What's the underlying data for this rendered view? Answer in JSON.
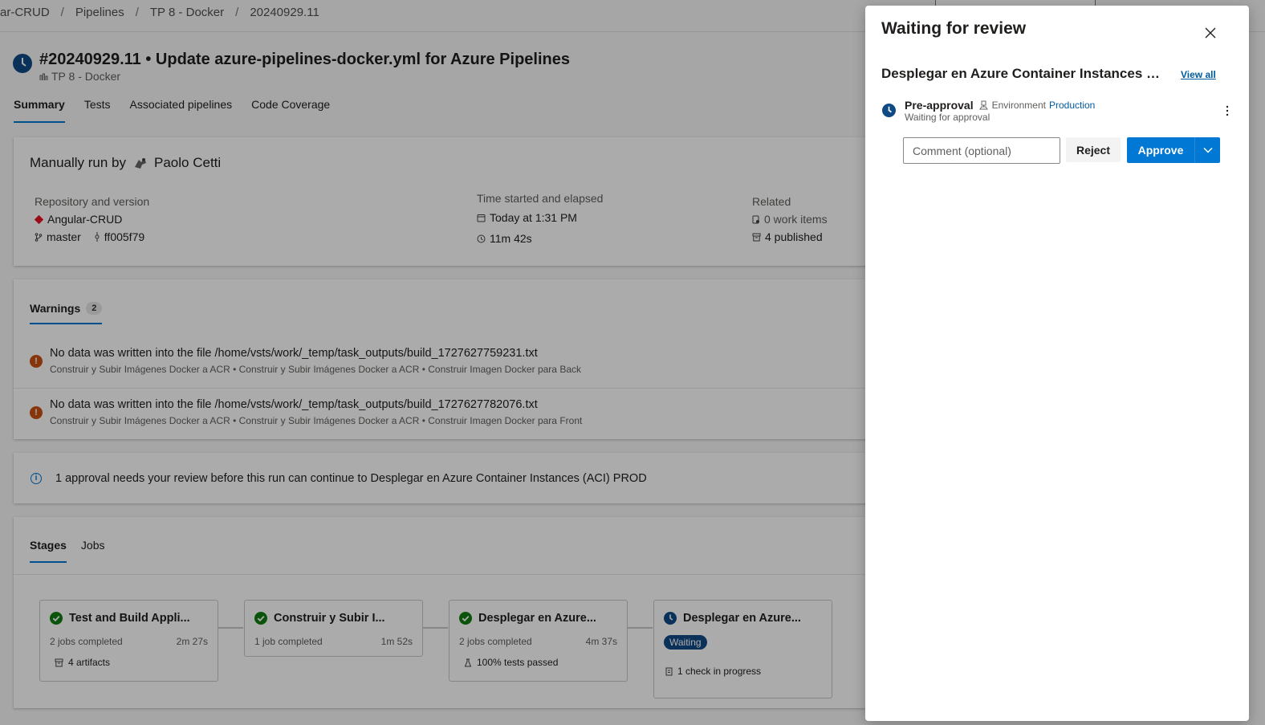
{
  "breadcrumb": [
    "ar-CRUD",
    "Pipelines",
    "TP 8 - Docker",
    "20240929.11"
  ],
  "run": {
    "title": "#20240929.11 • Update azure-pipelines-docker.yml for Azure Pipelines",
    "pipeline": "TP 8 - Docker"
  },
  "tabs": [
    "Summary",
    "Tests",
    "Associated pipelines",
    "Code Coverage"
  ],
  "summary": {
    "manual_prefix": "Manually run by",
    "user": "Paolo Cetti",
    "repo_heading": "Repository and version",
    "repo": "Angular-CRUD",
    "branch": "master",
    "commit": "ff005f79",
    "time_heading": "Time started and elapsed",
    "started": "Today at 1:31 PM",
    "elapsed": "11m 42s",
    "related_heading": "Related",
    "work_items": "0 work items",
    "published": "4 published"
  },
  "warnings": {
    "label": "Warnings",
    "count": "2",
    "items": [
      {
        "message": "No data was written into the file /home/vsts/work/_temp/task_outputs/build_1727627759231.txt",
        "path": "Construir y Subir Imágenes Docker a ACR • Construir y Subir Imágenes Docker a ACR • Construir Imagen Docker para Back"
      },
      {
        "message": "No data was written into the file /home/vsts/work/_temp/task_outputs/build_1727627782076.txt",
        "path": "Construir y Subir Imágenes Docker a ACR • Construir y Subir Imágenes Docker a ACR • Construir Imagen Docker para Front"
      }
    ]
  },
  "info_banner": "1 approval needs your review before this run can continue to Desplegar en Azure Container Instances (ACI) PROD",
  "stages_tabs": [
    "Stages",
    "Jobs"
  ],
  "stages": [
    {
      "name": "Test and Build Appli...",
      "jobs": "2 jobs completed",
      "time": "2m 27s",
      "extra": "4 artifacts",
      "status": "success"
    },
    {
      "name": "Construir y Subir I...",
      "jobs": "1 job completed",
      "time": "1m 52s",
      "extra": "",
      "status": "success"
    },
    {
      "name": "Desplegar en Azure...",
      "jobs": "2 jobs completed",
      "time": "4m 37s",
      "extra": "100% tests passed",
      "status": "success"
    },
    {
      "name": "Desplegar en Azure...",
      "status_label": "Waiting",
      "extra": "1 check in progress",
      "status": "waiting"
    }
  ],
  "panel": {
    "title": "Waiting for review",
    "stage_name": "Desplegar en Azure Container Instances (ACI) PROD",
    "view_all": "View all",
    "approval_title": "Pre-approval",
    "env_label": "Environment",
    "env_name": "Production",
    "status": "Waiting for approval",
    "comment_placeholder": "Comment (optional)",
    "reject": "Reject",
    "approve": "Approve"
  },
  "colors": {
    "accent": "#0078d4",
    "success": "#107c10",
    "warning": "#ca5010",
    "waiting": "#0f4a85"
  }
}
